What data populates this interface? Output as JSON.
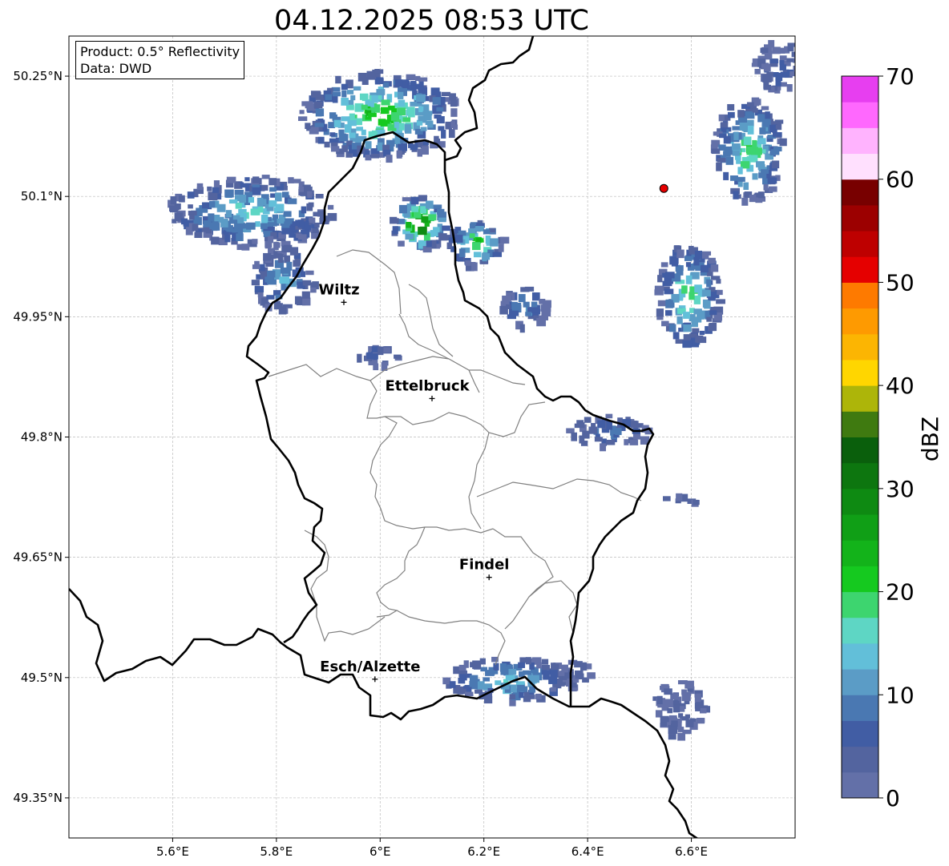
{
  "title": "04.12.2025 08:53 UTC",
  "info": {
    "product": "Product: 0.5° Reflectivity",
    "data": "Data: DWD"
  },
  "map": {
    "lon_range": [
      5.4,
      6.8
    ],
    "lat_range": [
      49.3,
      50.3
    ],
    "lon_ticks": [
      5.6,
      5.8,
      6.0,
      6.2,
      6.4,
      6.6
    ],
    "lon_tick_labels": [
      "5.6°E",
      "5.8°E",
      "6°E",
      "6.2°E",
      "6.4°E",
      "6.6°E"
    ],
    "lat_ticks": [
      49.35,
      49.5,
      49.65,
      49.8,
      49.95,
      50.1,
      50.25
    ],
    "lat_tick_labels": [
      "49.35°N",
      "49.5°N",
      "49.65°N",
      "49.8°N",
      "49.95°N",
      "50.1°N",
      "50.25°N"
    ],
    "grid": true,
    "cities": [
      {
        "name": "Wiltz",
        "lon": 5.93,
        "lat": 49.968
      },
      {
        "name": "Ettelbruck",
        "lon": 6.1,
        "lat": 49.848
      },
      {
        "name": "Findel",
        "lon": 6.21,
        "lat": 49.625
      },
      {
        "name": "Esch/Alzette",
        "lon": 5.99,
        "lat": 49.498
      }
    ],
    "radar_site": {
      "lon": 6.547,
      "lat": 50.11,
      "color": "#e60000"
    }
  },
  "colorbar": {
    "label": "dBZ",
    "min": 0,
    "max": 70,
    "step": 2.5,
    "tick_values": [
      0,
      10,
      20,
      30,
      40,
      50,
      60,
      70
    ],
    "tick_labels": [
      "0",
      "10",
      "20",
      "30",
      "40",
      "50",
      "60",
      "70"
    ],
    "colors": [
      "#6370a8",
      "#53649f",
      "#415da4",
      "#4a78b2",
      "#5b9cc6",
      "#62bfd9",
      "#5ed6c4",
      "#3dd56f",
      "#15c91f",
      "#13b31a",
      "#109f16",
      "#0e8a12",
      "#0d760f",
      "#0a5f0c",
      "#3f7a10",
      "#adb509",
      "#ffd600",
      "#fcb502",
      "#fe9a01",
      "#fe7a00",
      "#e50000",
      "#be0000",
      "#9c0000",
      "#780000",
      "#ffe0fe",
      "#ffb3fe",
      "#ff68fe",
      "#e73ef0"
    ]
  },
  "chart_data": {
    "type": "heatmap",
    "title": "04.12.2025 08:53 UTC",
    "colorbar_label": "dBZ",
    "value_range": [
      0,
      70
    ],
    "echo_regions": [
      {
        "area": "north-central near 50.15N 6.05E",
        "max_dbz": 32
      },
      {
        "area": "north-west near 50.08N 5.75E",
        "max_dbz": 20
      },
      {
        "area": "north-east near 50.15N 6.72E",
        "max_dbz": 25
      },
      {
        "area": "east near 49.98N 6.58E",
        "max_dbz": 22
      },
      {
        "area": "south near 49.50N 6.25E",
        "max_dbz": 17
      },
      {
        "area": "south-east near 49.46N 6.58E",
        "max_dbz": 10
      }
    ]
  }
}
